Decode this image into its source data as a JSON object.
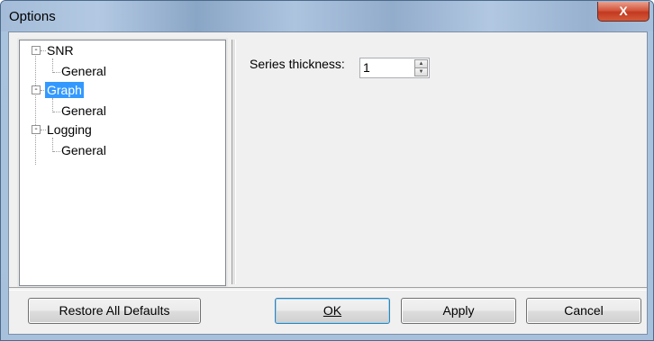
{
  "window": {
    "title": "Options",
    "close_glyph": "X",
    "close_icon": "close-icon"
  },
  "tree": {
    "nodes": [
      {
        "label": "SNR",
        "expander": "-"
      },
      {
        "label": "General"
      },
      {
        "label": "Graph",
        "expander": "-",
        "selected": true
      },
      {
        "label": "General"
      },
      {
        "label": "Logging",
        "expander": "-"
      },
      {
        "label": "General"
      }
    ]
  },
  "settings": {
    "series_thickness_label": "Series thickness:",
    "series_thickness_value": "1",
    "spin_up_glyph": "▲",
    "spin_down_glyph": "▼"
  },
  "buttons": {
    "restore_label": "Restore All Defaults",
    "ok_label": "OK",
    "apply_label": "Apply",
    "cancel_label": "Cancel"
  },
  "colors": {
    "selection": "#3399ff",
    "close_button": "#c7432a"
  }
}
